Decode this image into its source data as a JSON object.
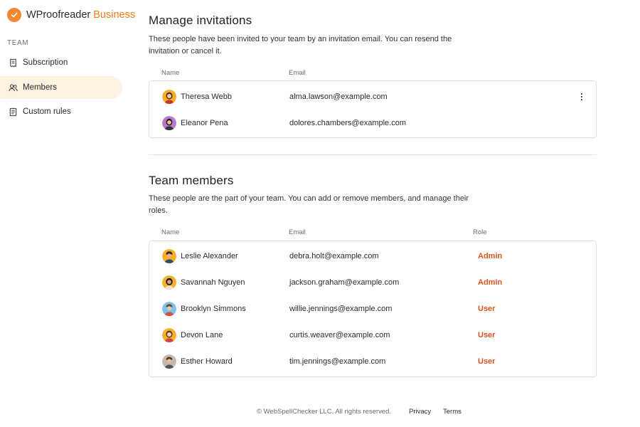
{
  "brand": {
    "name": "WProofreader",
    "accent": "Business",
    "accent_color": "#ef7d1a",
    "logo_icon": "checkmark-icon"
  },
  "sidebar": {
    "section_label": "TEAM",
    "items": [
      {
        "label": "Subscription",
        "icon": "receipt-icon",
        "active": false
      },
      {
        "label": "Members",
        "icon": "users-icon",
        "active": true
      },
      {
        "label": "Custom rules",
        "icon": "document-icon",
        "active": false
      }
    ]
  },
  "invitations": {
    "title": "Manage invitations",
    "description": "These people have been invited to your team by an invitation email. You can resend the invitation or cancel it.",
    "columns": {
      "name": "Name",
      "email": "Email"
    },
    "rows": [
      {
        "name": "Theresa Webb",
        "email": "alma.lawson@example.com"
      },
      {
        "name": "Eleanor Pena",
        "email": "dolores.chambers@example.com"
      }
    ]
  },
  "members": {
    "title": "Team members",
    "description": "These people are the part of your team. You can add or remove members, and manage their roles.",
    "columns": {
      "name": "Name",
      "email": "Email",
      "role": "Role"
    },
    "rows": [
      {
        "name": "Leslie Alexander",
        "email": "debra.holt@example.com",
        "role": "Admin"
      },
      {
        "name": "Savannah Nguyen",
        "email": "jackson.graham@example.com",
        "role": "Admin"
      },
      {
        "name": "Brooklyn Simmons",
        "email": "willie.jennings@example.com",
        "role": "User"
      },
      {
        "name": "Devon Lane",
        "email": "curtis.weaver@example.com",
        "role": "User"
      },
      {
        "name": "Esther Howard",
        "email": "tim.jennings@example.com",
        "role": "User"
      }
    ]
  },
  "footer": {
    "copyright": "© WebSpellChecker LLC. All rights reserved.",
    "privacy": "Privacy",
    "terms": "Terms"
  },
  "colors": {
    "role": "#d9541b",
    "active_nav_bg": "#fdf1e2",
    "logo": "#f0892f"
  }
}
